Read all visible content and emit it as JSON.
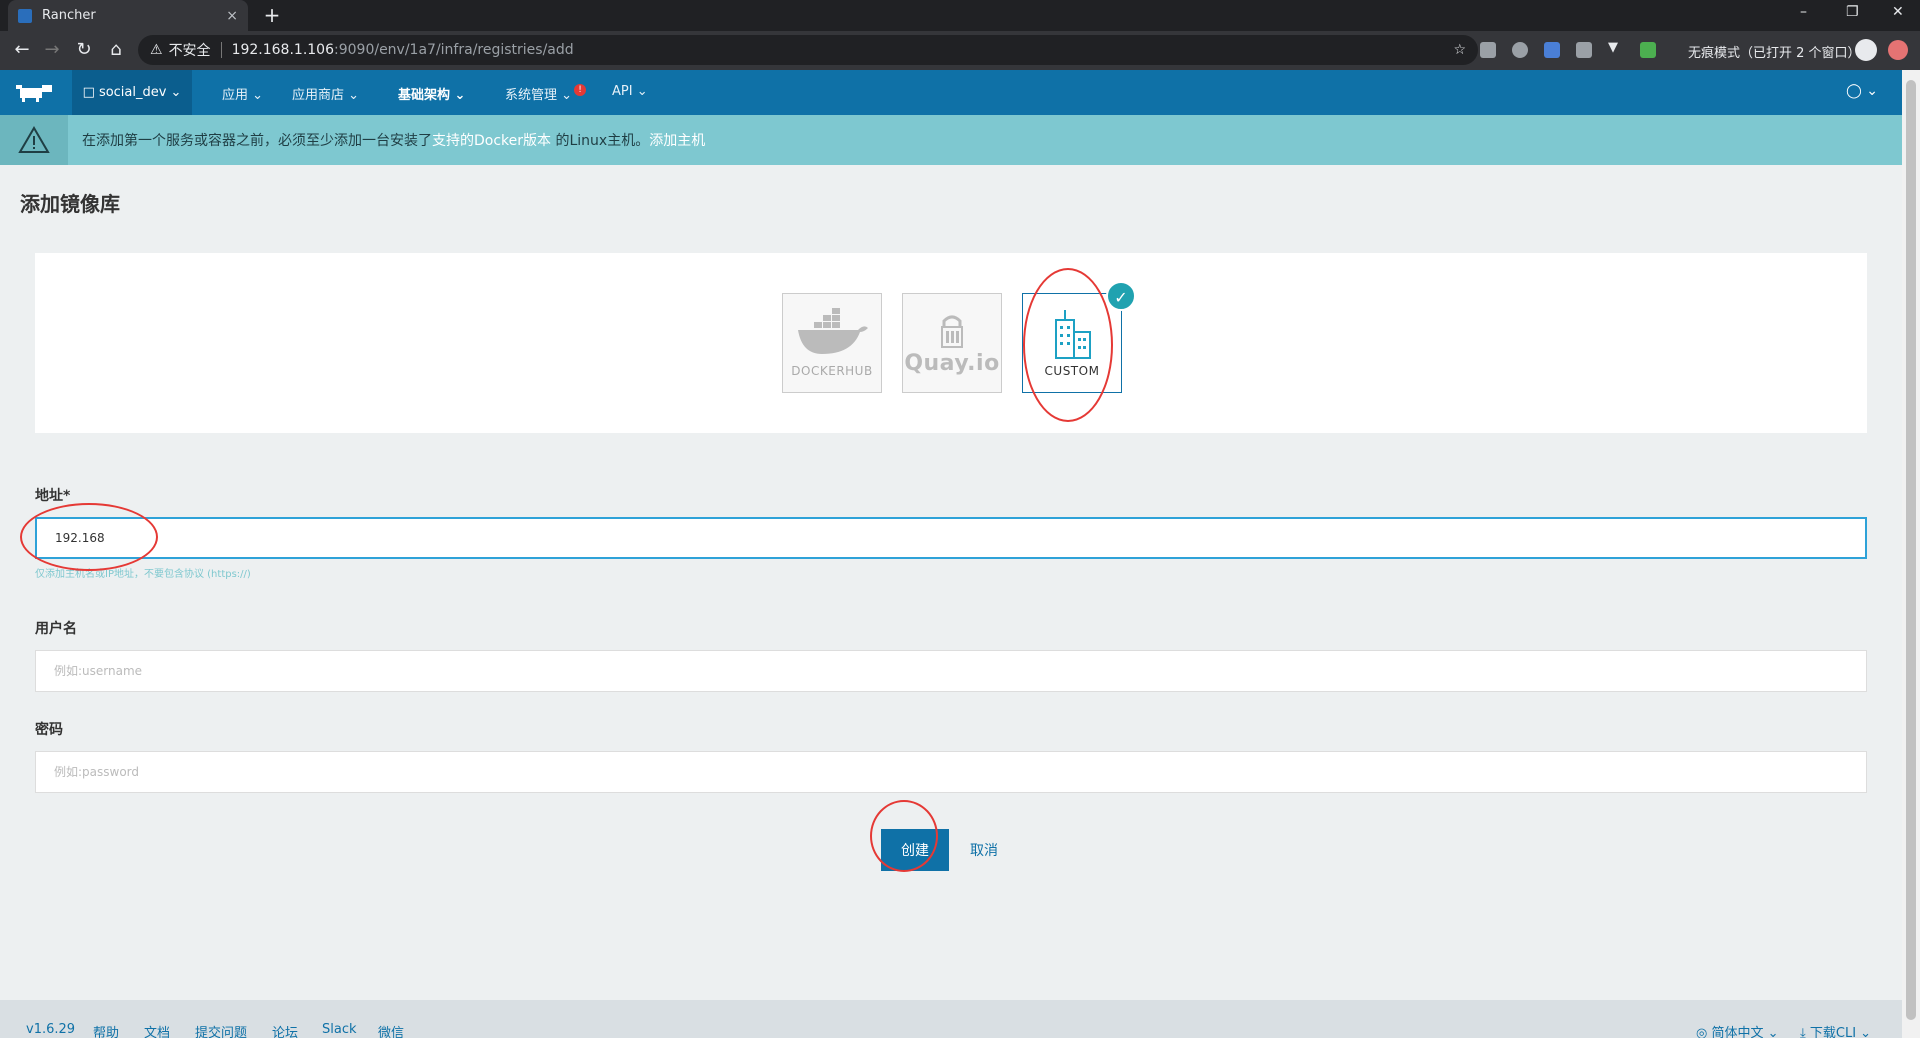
{
  "browser": {
    "tab_title": "Rancher",
    "tab_close": "×",
    "new_tab": "+",
    "security_label": "不安全",
    "url_host": "192.168.1.106",
    "url_path": ":9090/env/1a7/infra/registries/add",
    "incognito_label": "无痕模式（已打开 2 个窗口）"
  },
  "app": {
    "environment": "social_dev",
    "nav": [
      {
        "label": "应用"
      },
      {
        "label": "应用商店"
      },
      {
        "label": "基础架构"
      },
      {
        "label": "系统管理"
      },
      {
        "label": "API"
      }
    ],
    "alert_badge": "!"
  },
  "banner": {
    "text_before": "在添加第一个服务或容器之前，必须至少添加一台安装了",
    "link1": "支持的Docker版本",
    "text_middle": " 的Linux主机。",
    "link2": "添加主机"
  },
  "page": {
    "title": "添加镜像库"
  },
  "registry_types": [
    {
      "label": "DOCKERHUB",
      "selected": false
    },
    {
      "label": "Quay.io",
      "selected": false
    },
    {
      "label": "CUSTOM",
      "selected": true
    }
  ],
  "form": {
    "address_label": "地址*",
    "address_value": "192.168",
    "address_help": "仅添加主机名或IP地址，不要包含协议 (https://)",
    "username_label": "用户名",
    "username_placeholder": "例如:username",
    "password_label": "密码",
    "password_placeholder": "例如:password",
    "create_label": "创建",
    "cancel_label": "取消"
  },
  "footer": {
    "version": "v1.6.29",
    "links": [
      "帮助",
      "文档",
      "提交问题",
      "论坛",
      "Slack",
      "微信"
    ],
    "language": "简体中文",
    "download": "下载CLI"
  },
  "colors": {
    "brand": "#0f71a7",
    "banner": "#7ec8d0",
    "annotation": "#e53935"
  }
}
